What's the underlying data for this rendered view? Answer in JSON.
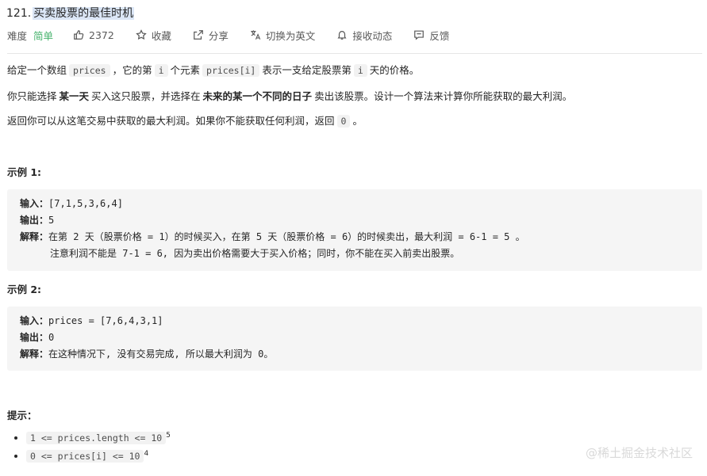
{
  "problem": {
    "number": "121.",
    "title": "买卖股票的最佳时机"
  },
  "meta": {
    "difficulty_label": "难度",
    "difficulty_value": "简单",
    "likes": "2372",
    "favorite": "收藏",
    "share": "分享",
    "switch_lang": "切换为英文",
    "notify": "接收动态",
    "feedback": "反馈",
    "difficulty_color": "#45b26b"
  },
  "description": {
    "p1_a": "给定一个数组",
    "p1_code1": "prices",
    "p1_b": "，它的第",
    "p1_code2": "i",
    "p1_c": "个元素",
    "p1_code3": "prices[i]",
    "p1_d": "表示一支给定股票第",
    "p1_code4": "i",
    "p1_e": "天的价格。",
    "p2_a": "你只能选择",
    "p2_bold1": "某一天",
    "p2_b": "买入这只股票，并选择在",
    "p2_bold2": "未来的某一个不同的日子",
    "p2_c": "卖出该股票。设计一个算法来计算你所能获取的最大利润。",
    "p3_a": "返回你可以从这笔交易中获取的最大利润。如果你不能获取任何利润，返回",
    "p3_code": "0",
    "p3_b": "。"
  },
  "example1": {
    "heading": "示例 1:",
    "input_label": "输入：",
    "input_value": "[7,1,5,3,6,4]",
    "output_label": "输出：",
    "output_value": "5",
    "explain_label": "解释：",
    "explain_line1": "在第 2 天（股票价格 = 1）的时候买入，在第 5 天（股票价格 = 6）的时候卖出，最大利润 = 6-1 = 5 。",
    "explain_line2": "注意利润不能是 7-1 = 6, 因为卖出价格需要大于买入价格；同时，你不能在买入前卖出股票。"
  },
  "example2": {
    "heading": "示例 2:",
    "input_label": "输入：",
    "input_value": "prices = [7,6,4,3,1]",
    "output_label": "输出：",
    "output_value": "0",
    "explain_label": "解释：",
    "explain_line1": "在这种情况下, 没有交易完成, 所以最大利润为 0。"
  },
  "hints": {
    "heading": "提示：",
    "items": [
      {
        "code": "1 <= prices.length <= 10",
        "sup": "5"
      },
      {
        "code": "0 <= prices[i] <= 10",
        "sup": "4"
      }
    ]
  },
  "watermark": "@稀土掘金技术社区"
}
